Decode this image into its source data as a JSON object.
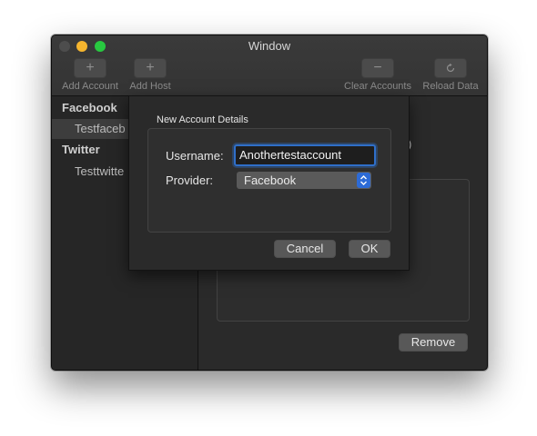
{
  "window": {
    "title": "Window",
    "accent_color": "#2d6bd6"
  },
  "toolbar": {
    "items": [
      {
        "label": "Add Account",
        "icon": "plus-icon"
      },
      {
        "label": "Add Host",
        "icon": "plus-icon"
      },
      {
        "label": "Clear Accounts",
        "icon": "minus-icon"
      },
      {
        "label": "Reload Data",
        "icon": "reload-icon"
      }
    ]
  },
  "sidebar": {
    "groups": [
      {
        "header": "Facebook",
        "items": [
          "Testfaceb"
        ]
      },
      {
        "header": "Twitter",
        "items": [
          "Testtwitte"
        ]
      }
    ]
  },
  "main": {
    "partial_text": ")",
    "remove_label": "Remove"
  },
  "sheet": {
    "title": "New Account Details",
    "username_label": "Username:",
    "username_value": "Anothertestaccount",
    "provider_label": "Provider:",
    "provider_value": "Facebook",
    "cancel_label": "Cancel",
    "ok_label": "OK"
  }
}
